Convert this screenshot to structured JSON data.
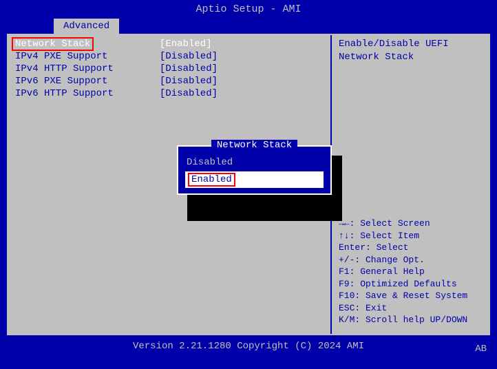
{
  "header": {
    "title": "Aptio Setup - AMI"
  },
  "tab": {
    "active": "Advanced"
  },
  "settings": [
    {
      "label": "Network Stack",
      "value": "[Enabled]",
      "selected": true
    },
    {
      "label": "IPv4 PXE Support",
      "value": "[Disabled]",
      "selected": false
    },
    {
      "label": "IPv4 HTTP Support",
      "value": "[Disabled]",
      "selected": false
    },
    {
      "label": "IPv6 PXE Support",
      "value": "[Disabled]",
      "selected": false
    },
    {
      "label": "IPv6 HTTP Support",
      "value": "[Disabled]",
      "selected": false
    }
  ],
  "help": {
    "description": [
      "Enable/Disable UEFI",
      "Network Stack"
    ],
    "keys": [
      "→←: Select Screen",
      "↑↓: Select Item",
      "Enter: Select",
      "+/-: Change Opt.",
      "F1: General Help",
      "F9: Optimized Defaults",
      "F10: Save & Reset System",
      "ESC: Exit",
      "K/M: Scroll help UP/DOWN"
    ]
  },
  "popup": {
    "title": "Network Stack",
    "options": [
      {
        "label": "Disabled",
        "selected": false
      },
      {
        "label": "Enabled",
        "selected": true
      }
    ]
  },
  "footer": {
    "version": "Version 2.21.1280 Copyright (C) 2024 AMI",
    "marker": "AB"
  }
}
